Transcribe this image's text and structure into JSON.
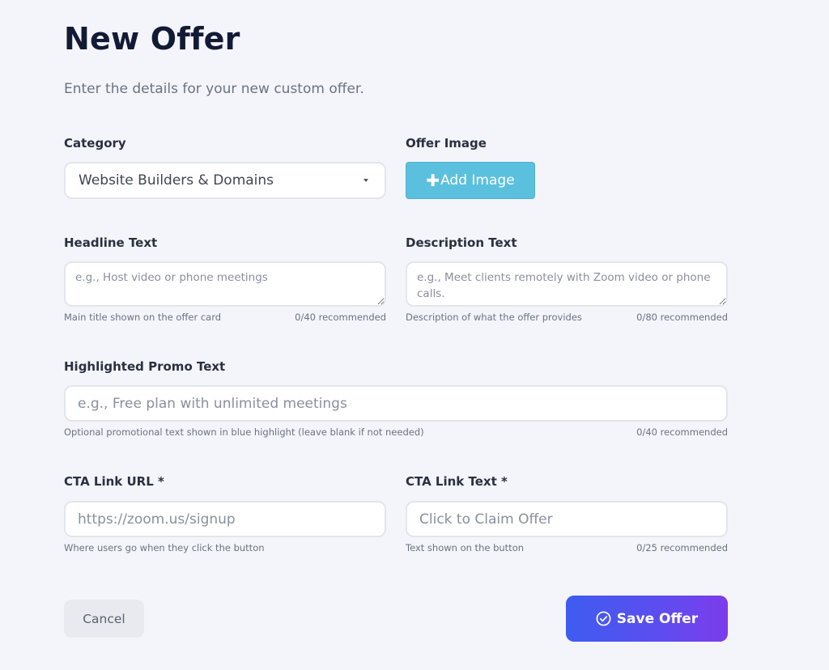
{
  "page": {
    "title": "New Offer",
    "subtitle": "Enter the details for your new custom offer."
  },
  "category": {
    "label": "Category",
    "value": "Website Builders & Domains"
  },
  "offer_image": {
    "label": "Offer Image",
    "button_label": "Add Image",
    "button_icon": "plus-icon"
  },
  "headline": {
    "label": "Headline Text",
    "placeholder": "e.g., Host video or phone meetings",
    "help": "Main title shown on the offer card",
    "count": "0/40 recommended"
  },
  "description": {
    "label": "Description Text",
    "placeholder": "e.g., Meet clients remotely with Zoom video or phone calls.",
    "help": "Description of what the offer provides",
    "count": "0/80 recommended"
  },
  "promo": {
    "label": "Highlighted Promo Text",
    "placeholder": "e.g., Free plan with unlimited meetings",
    "help": "Optional promotional text shown in blue highlight (leave blank if not needed)",
    "count": "0/40 recommended"
  },
  "cta_url": {
    "label": "CTA Link URL *",
    "placeholder": "https://zoom.us/signup",
    "help": "Where users go when they click the button"
  },
  "cta_text": {
    "label": "CTA Link Text *",
    "placeholder": "Click to Claim Offer",
    "help": "Text shown on the button",
    "count": "0/25 recommended"
  },
  "actions": {
    "cancel_label": "Cancel",
    "save_label": "Save Offer",
    "save_icon": "check-circle-icon"
  },
  "colors": {
    "background": "#f4f5fa",
    "add_image_button": "#5bc0de",
    "save_gradient_start": "#3e5cf0",
    "save_gradient_end": "#7d3ceb",
    "cancel_button": "#e9eaef"
  }
}
